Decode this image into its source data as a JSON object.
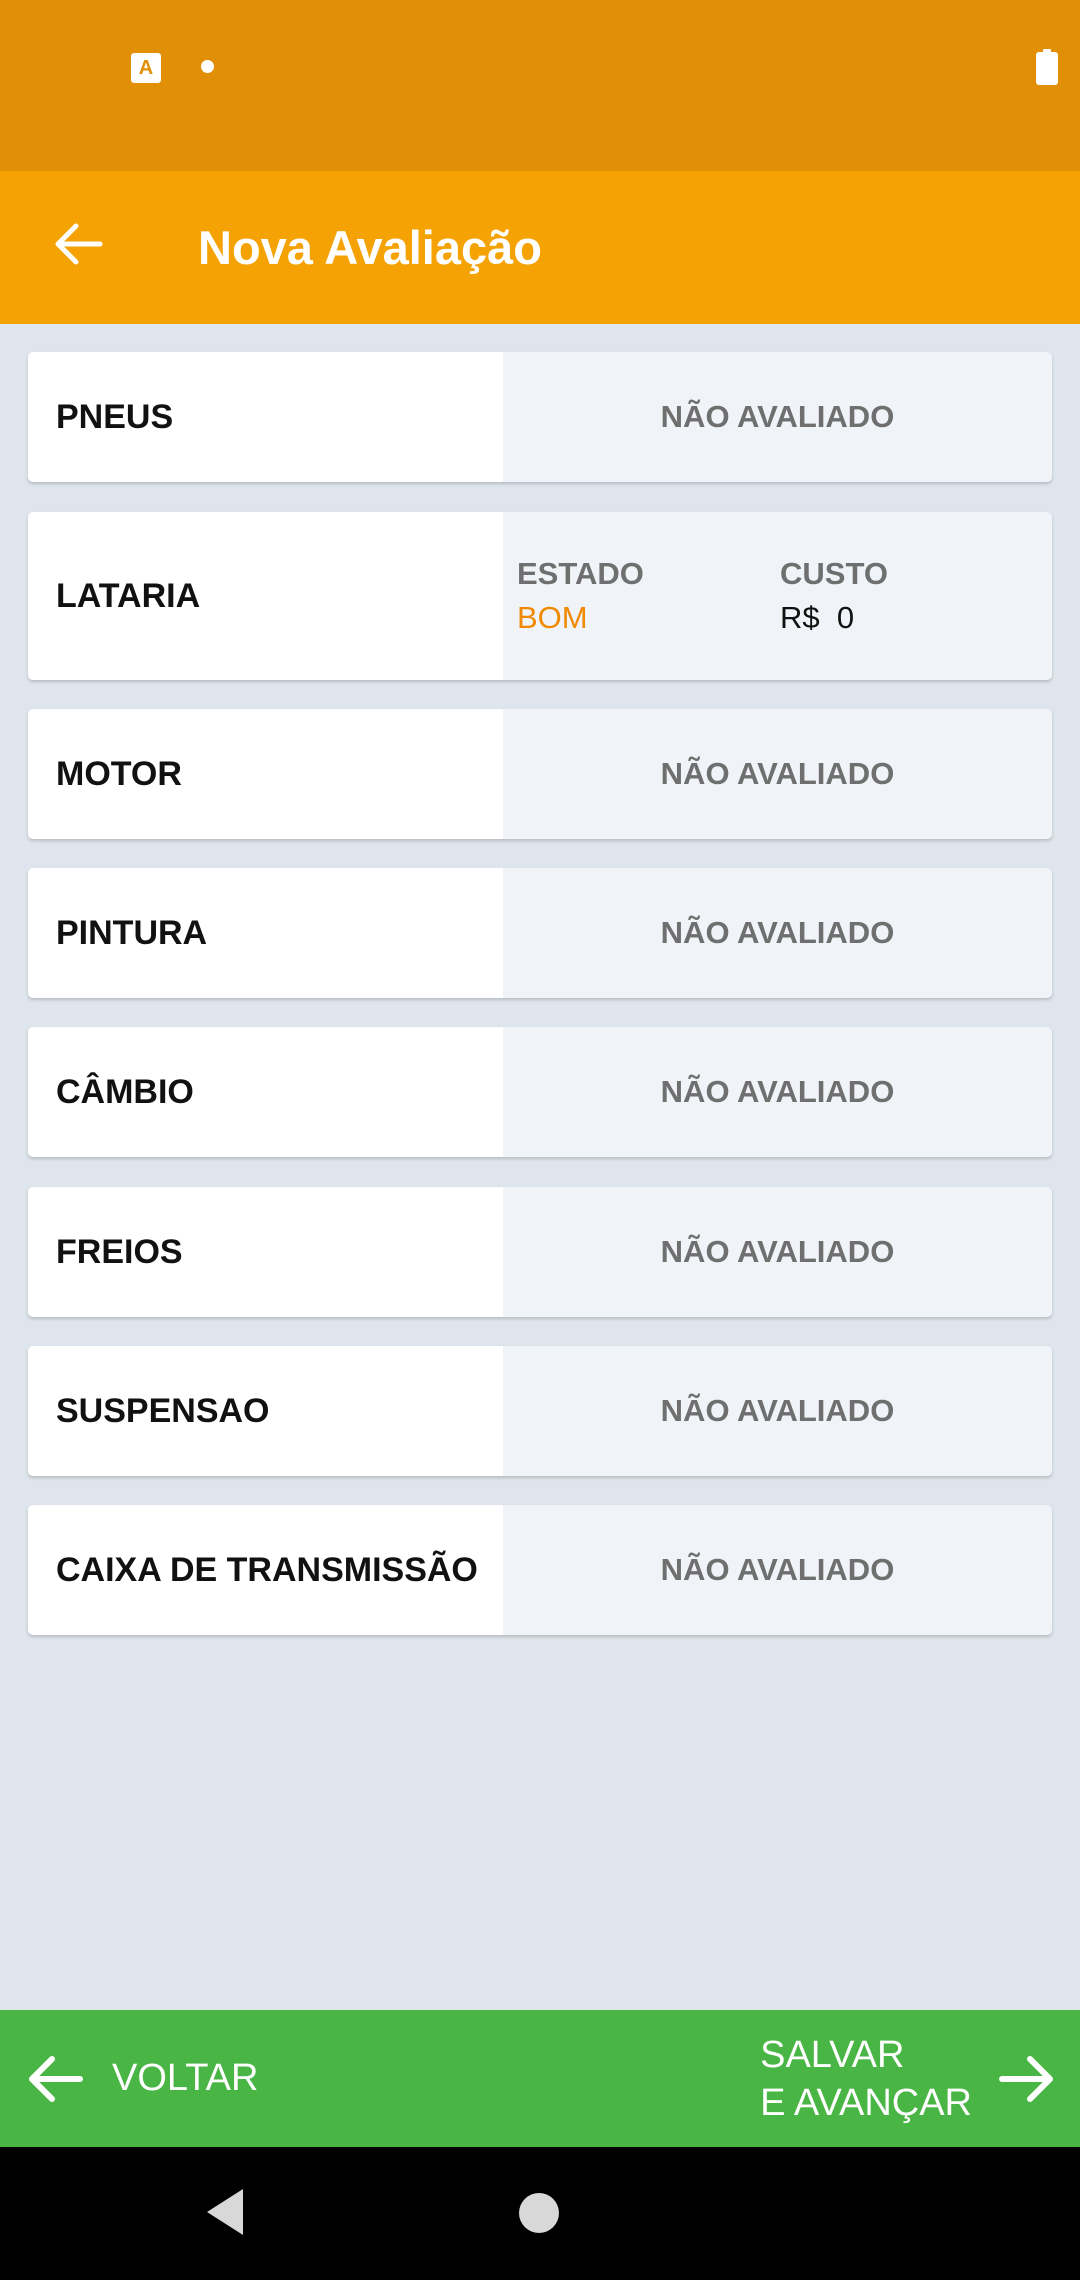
{
  "status_bar": {
    "icons": [
      "a-notification-icon",
      "dot-icon",
      "battery-icon"
    ],
    "a_icon_glyph": "A"
  },
  "app_bar": {
    "title": "Nova Avaliação",
    "back_icon": "arrow-left-icon"
  },
  "items": [
    {
      "label": "PNEUS",
      "status": "NÃO AVALIADO"
    },
    {
      "label": "LATARIA",
      "estado_header": "ESTADO",
      "estado_value": "BOM",
      "custo_header": "CUSTO",
      "custo_value": "R$  0"
    },
    {
      "label": "MOTOR",
      "status": "NÃO AVALIADO"
    },
    {
      "label": "PINTURA",
      "status": "NÃO AVALIADO"
    },
    {
      "label": "CÂMBIO",
      "status": "NÃO AVALIADO"
    },
    {
      "label": "FREIOS",
      "status": "NÃO AVALIADO"
    },
    {
      "label": "SUSPENSAO",
      "status": "NÃO AVALIADO"
    },
    {
      "label": "CAIXA DE TRANSMISSÃO",
      "status": "NÃO AVALIADO"
    }
  ],
  "bottom_bar": {
    "back_label": "VOLTAR",
    "next_label_line1": "SALVAR",
    "next_label_line2": "E AVANÇAR"
  },
  "colors": {
    "status_bar": "#e08f07",
    "app_bar": "#f5a204",
    "accent_orange": "#f08a00",
    "bottom_bar": "#49b544",
    "background": "#dfe5ec"
  }
}
